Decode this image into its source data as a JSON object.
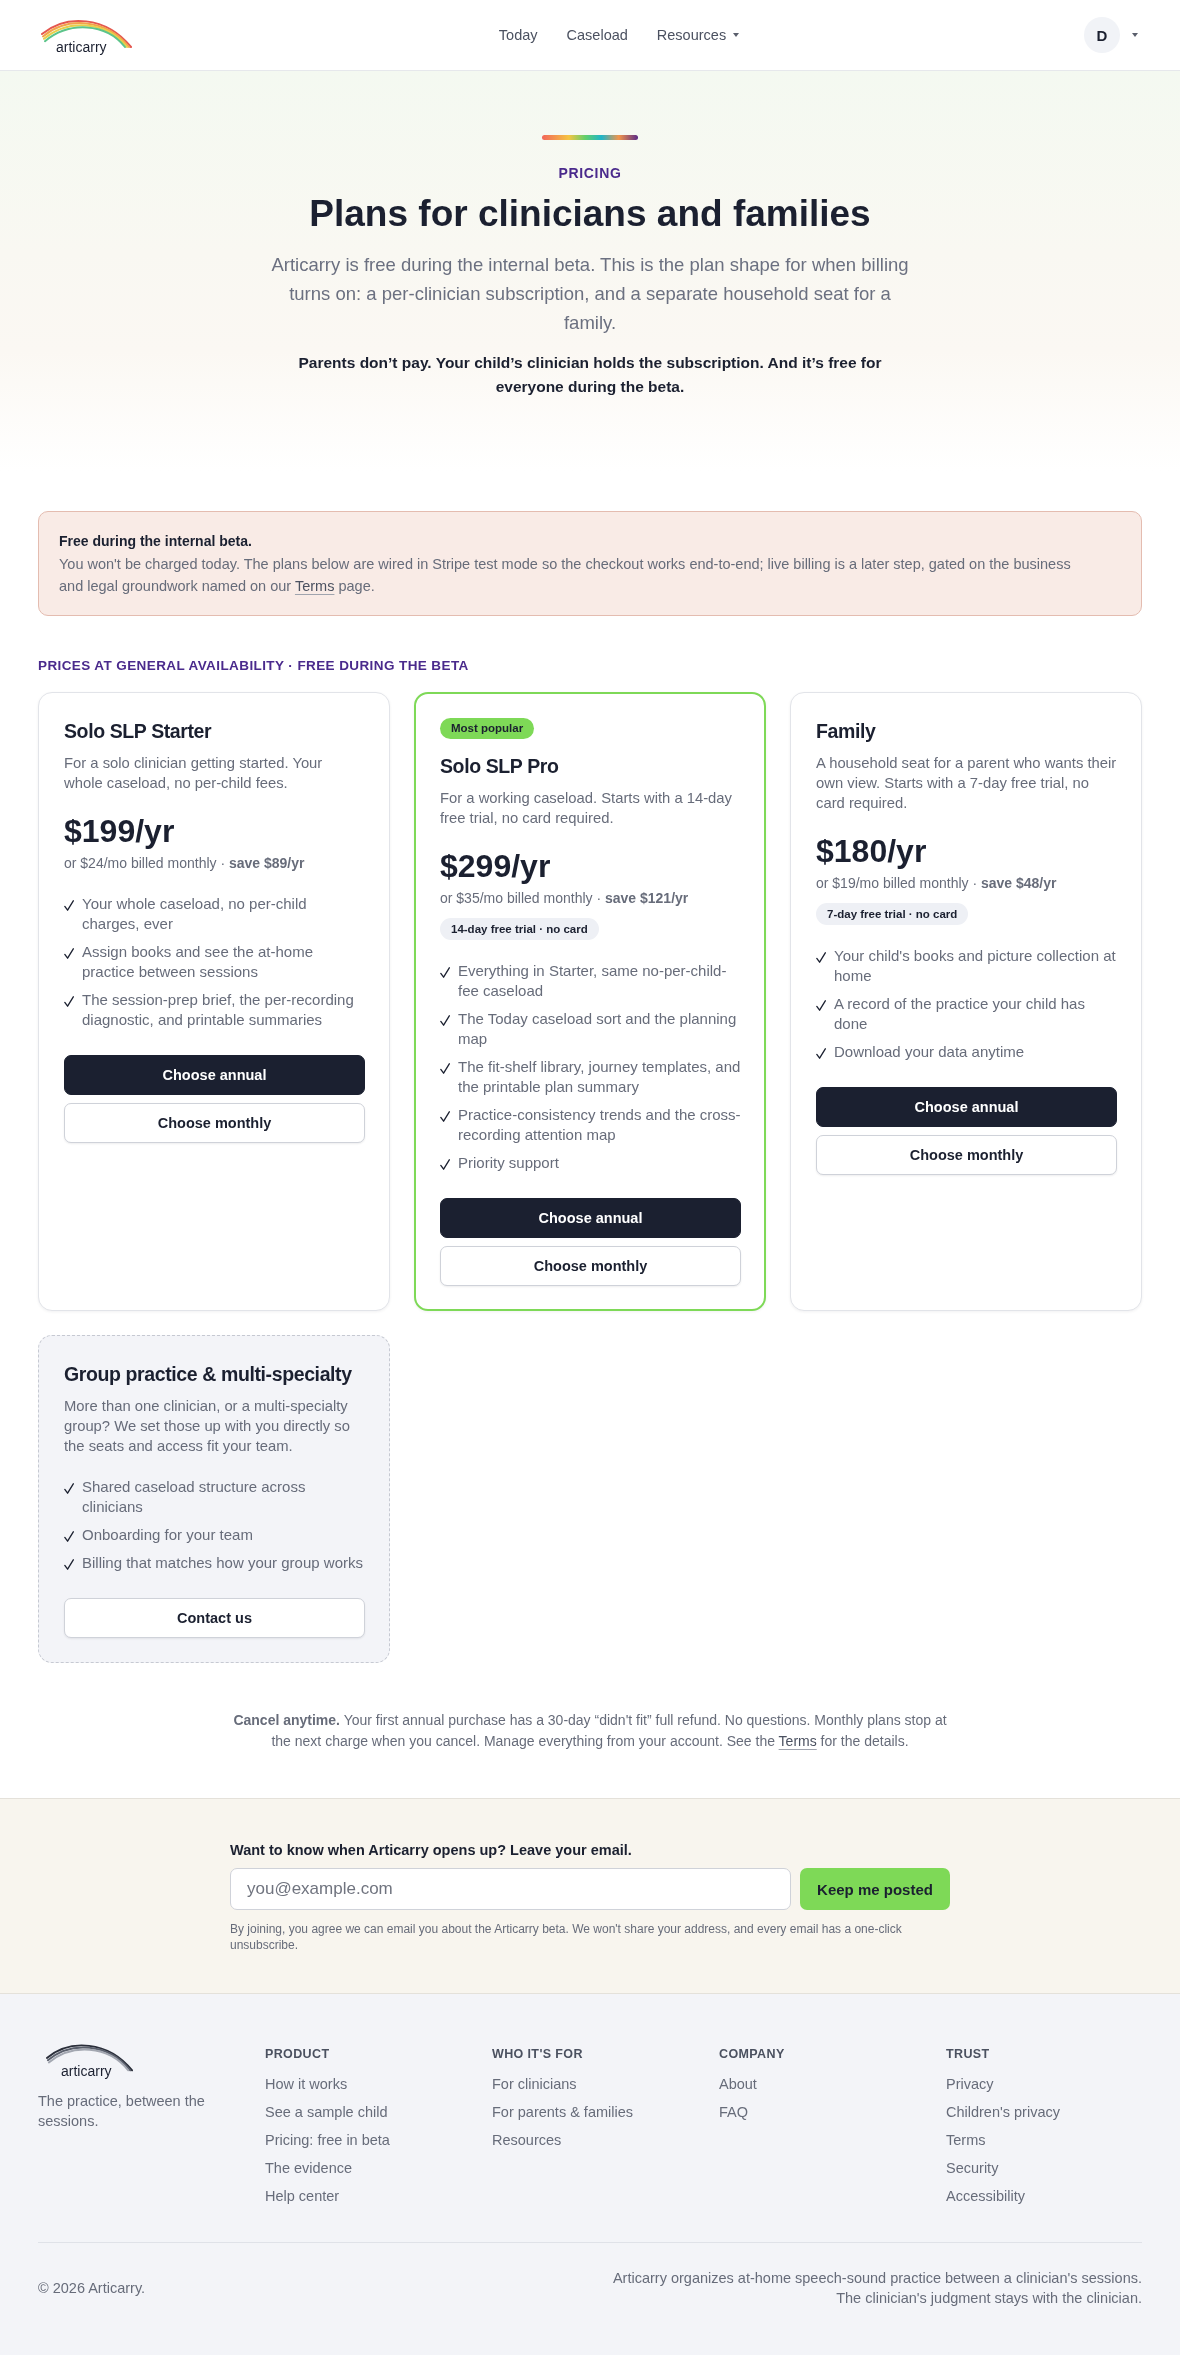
{
  "header": {
    "logo_text": "articarry",
    "nav": [
      {
        "label": "Today",
        "kind": "link"
      },
      {
        "label": "Caseload",
        "kind": "link"
      },
      {
        "label": "Resources",
        "kind": "menu"
      }
    ],
    "account": {
      "initial": "D"
    }
  },
  "hero": {
    "eyebrow": "PRICING",
    "title": "Plans for clinicians and families",
    "intro": "Articarry is free during the internal beta. This is the plan shape for when billing turns on: a per-clinician subscription, and a separate household seat for a family.",
    "emphasis": "Parents don’t pay. Your child’s clinician holds the subscription. And it’s free for everyone during the beta."
  },
  "notice": {
    "title": "Free during the internal beta.",
    "text_before": "You won't be charged today. The plans below are wired in Stripe test mode so the checkout works end-to-end; live billing is a later step, gated on the business and legal groundwork named on our ",
    "link": "Terms",
    "text_after": " page."
  },
  "section_label": "PRICES AT GENERAL AVAILABILITY · FREE DURING THE BETA",
  "plans": [
    {
      "kind": "tier",
      "featured": false,
      "name": "Solo SLP Starter",
      "description": "For a solo clinician getting started. Your whole caseload, no per-child fees.",
      "price": "$199/yr",
      "billing": "or $24/mo billed monthly · **save $89/yr**",
      "features": [
        "Your whole caseload, no per-child charges, ever",
        "Assign books and see the at-home practice between sessions",
        "The session-prep brief, the per-recording diagnostic, and printable summaries"
      ],
      "buttons": [
        {
          "label": "Choose annual",
          "kind": "primary"
        },
        {
          "label": "Choose monthly",
          "kind": "secondary"
        }
      ]
    },
    {
      "kind": "tier",
      "featured": true,
      "badge": "Most popular",
      "name": "Solo SLP Pro",
      "description": "For a working caseload. Starts with a 14-day free trial, no card required.",
      "price": "$299/yr",
      "billing": "or $35/mo billed monthly · **save $121/yr**",
      "trial": "14-day free trial · no card",
      "features": [
        "Everything in Starter, same no-per-child-fee caseload",
        "The Today caseload sort and the planning map",
        "The fit-shelf library, journey templates, and the printable plan summary",
        "Practice-consistency trends and the cross-recording attention map",
        "Priority support"
      ],
      "buttons": [
        {
          "label": "Choose annual",
          "kind": "primary"
        },
        {
          "label": "Choose monthly",
          "kind": "secondary"
        }
      ]
    },
    {
      "kind": "tier",
      "featured": false,
      "name": "Family",
      "description": "A household seat for a parent who wants their own view. Starts with a 7-day free trial, no card required.",
      "price": "$180/yr",
      "billing": "or $19/mo billed monthly · **save $48/yr**",
      "trial": "7-day free trial · no card",
      "features": [
        "Your child's books and picture collection at home",
        "A record of the practice your child has done",
        "Download your data anytime"
      ],
      "buttons": [
        {
          "label": "Choose annual",
          "kind": "primary"
        },
        {
          "label": "Choose monthly",
          "kind": "secondary"
        }
      ]
    },
    {
      "kind": "custom",
      "featured": false,
      "name": "Group practice & multi-specialty",
      "description": "More than one clinician, or a multi-specialty group? We set those up with you directly so the seats and access fit your team.",
      "features": [
        "Shared caseload structure across clinicians",
        "Onboarding for your team",
        "Billing that matches how your group works"
      ],
      "buttons": [
        {
          "label": "Contact us",
          "kind": "secondary"
        }
      ]
    }
  ],
  "cancel_note": {
    "text_before": "**Cancel anytime.** Your first annual purchase has a 30-day “didn't fit” full refund. No questions. Monthly plans stop at the next charge when you cancel. Manage everything from your account. See the ",
    "link": "Terms",
    "text_after": " for the details."
  },
  "signup": {
    "label": "Want to know when Articarry opens up? Leave your email.",
    "placeholder": "you@example.com",
    "button": "Keep me posted",
    "note": "By joining, you agree we can email you about the Articarry beta. We won't share your address, and every email has a one-click unsubscribe."
  },
  "footer": {
    "logo_text": "articarry",
    "tagline": "The practice, between the sessions.",
    "columns": [
      {
        "heading": "PRODUCT",
        "links": [
          "How it works",
          "See a sample child",
          "Pricing: free in beta",
          "The evidence",
          "Help center"
        ]
      },
      {
        "heading": "WHO IT'S FOR",
        "links": [
          "For clinicians",
          "For parents & families",
          "Resources"
        ]
      },
      {
        "heading": "COMPANY",
        "links": [
          "About",
          "FAQ"
        ]
      },
      {
        "heading": "TRUST",
        "links": [
          "Privacy",
          "Children's privacy",
          "Terms",
          "Security",
          "Accessibility"
        ]
      }
    ],
    "copyright": "© 2026 Articarry.",
    "about": "Articarry organizes at-home speech-sound practice between a clinician's sessions. The clinician's judgment stays with the clinician."
  }
}
